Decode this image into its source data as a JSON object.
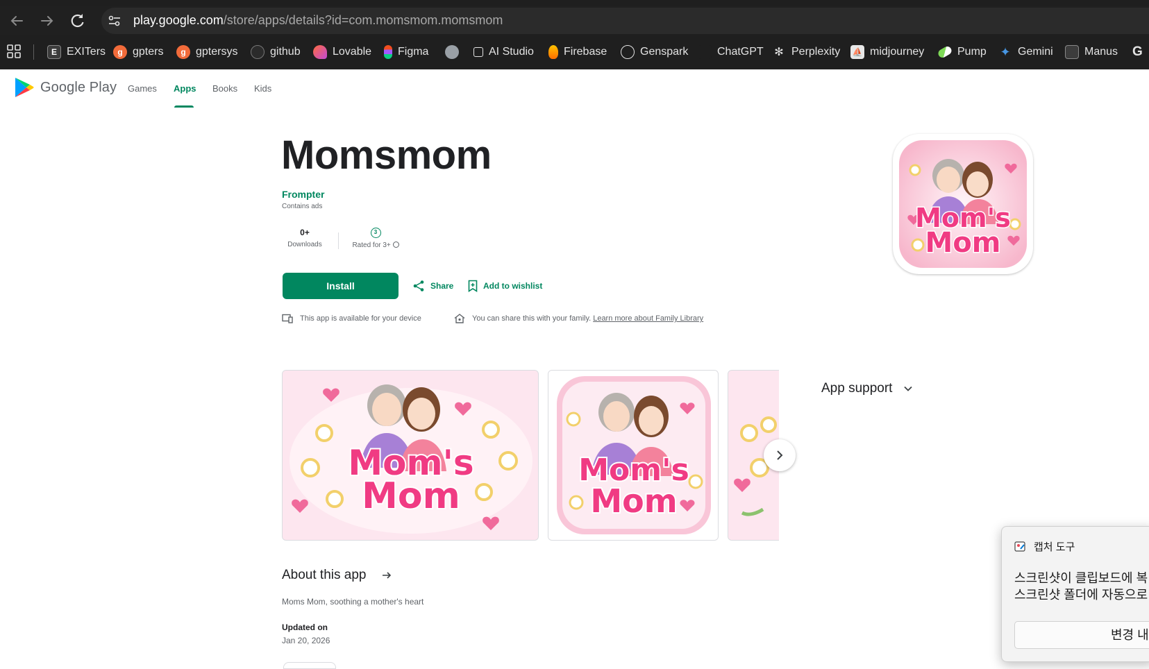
{
  "browser": {
    "url_host": "play.google.com",
    "url_path": "/store/apps/details?id=com.momsmom.momsmom",
    "bookmarks": [
      {
        "label": "EXITers",
        "icon": "exiters-icon",
        "color": "#3c3c3c"
      },
      {
        "label": "gpters",
        "icon": "gpters-icon",
        "color": "#f26b3a"
      },
      {
        "label": "gptersys",
        "icon": "gptersys-icon",
        "color": "#f26b3a"
      },
      {
        "label": "github",
        "icon": "github-icon",
        "color": "#2b2b2b"
      },
      {
        "label": "Lovable",
        "icon": "lovable-icon",
        "color": "#e14a8a"
      },
      {
        "label": "Figma",
        "icon": "figma-icon",
        "color": "#a259ff"
      },
      {
        "label": "",
        "icon": "globe-icon",
        "color": "#9aa0a6"
      },
      {
        "label": "AI Studio",
        "icon": "ai-studio-icon",
        "color": "#1f1f1f"
      },
      {
        "label": "Firebase",
        "icon": "firebase-icon",
        "color": "#ff9100"
      },
      {
        "label": "Genspark",
        "icon": "genspark-icon",
        "color": "#1f1f1f"
      },
      {
        "label": "ChatGPT",
        "icon": "chatgpt-icon",
        "color": "#1f1f1f"
      },
      {
        "label": "Perplexity",
        "icon": "perplexity-icon",
        "color": "#1f1f1f"
      },
      {
        "label": "midjourney",
        "icon": "midjourney-icon",
        "color": "#e8e8e8"
      },
      {
        "label": "Pump",
        "icon": "pump-icon",
        "color": "#7ed957"
      },
      {
        "label": "Gemini",
        "icon": "gemini-icon",
        "color": "#4796e3"
      },
      {
        "label": "Manus",
        "icon": "manus-icon",
        "color": "#3c3c3c"
      },
      {
        "label": "G",
        "icon": "google-icon",
        "color": "#1f1f1f"
      }
    ]
  },
  "play": {
    "logo_text": "Google Play",
    "tabs": [
      "Games",
      "Apps",
      "Books",
      "Kids"
    ],
    "active_tab": "Apps",
    "accent_color": "#01875f"
  },
  "app": {
    "title": "Momsmom",
    "developer": "Frompter",
    "contains_ads": "Contains ads",
    "downloads_value": "0+",
    "downloads_label": "Downloads",
    "rating_badge": "3",
    "rating_label": "Rated for 3+",
    "install_label": "Install",
    "share_label": "Share",
    "wishlist_label": "Add to wishlist",
    "device_note": "This app is available for your device",
    "family_note": "You can share this with your family.",
    "family_link": "Learn more about Family Library",
    "icon_text_1": "Mom's",
    "icon_text_2": "Mom"
  },
  "app_support": {
    "label": "App support"
  },
  "about": {
    "heading": "About this app",
    "description": "Moms Mom, soothing a mother's heart",
    "updated_label": "Updated on",
    "updated_value": "Jan 20, 2026"
  },
  "toast": {
    "app_name": "캡처 도구",
    "message_line1": "스크린샷이 클립보드에 복",
    "message_line2": "스크린샷 폴더에 자동으로",
    "button_label": "변경 내"
  }
}
